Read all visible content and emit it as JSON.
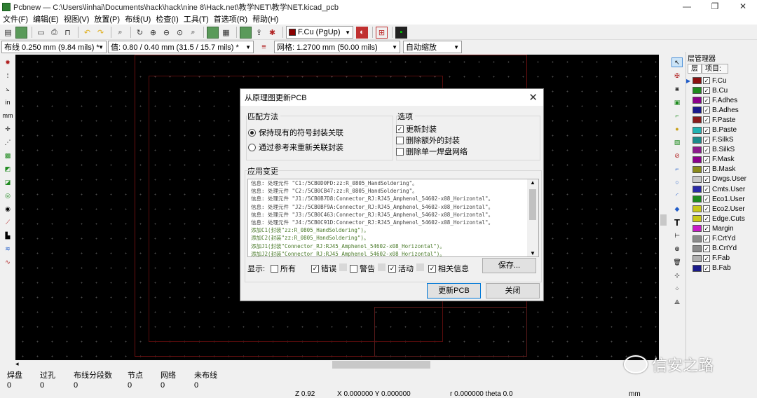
{
  "window": {
    "title": "Pcbnew — C:\\Users\\linhai\\Documents\\hack\\hack\\nine 8\\Hack.net\\教学NET\\教学NET.kicad_pcb",
    "min": "—",
    "restore": "❐",
    "close": "✕"
  },
  "menu": [
    "文件(F)",
    "编辑(E)",
    "视图(V)",
    "放置(P)",
    "布线(U)",
    "检查(I)",
    "工具(T)",
    "首选项(R)",
    "帮助(H)"
  ],
  "toolbar": {
    "layer_combo": "F.Cu (PgUp)",
    "layer_color": "#8b0000"
  },
  "toolbar2": {
    "track": "布线 0.250 mm (9.84 mils) *",
    "via": "值:  0.80 / 0.40 mm (31.5 / 15.7 mils) *",
    "grid": "网格: 1.2700 mm (50.00 mils)",
    "zoom": "自动缩放"
  },
  "layers_panel": {
    "title": "层管理器",
    "tab_layers": "层",
    "tab_items": "项目:",
    "items": [
      {
        "name": "F.Cu",
        "color": "#8b1010"
      },
      {
        "name": "B.Cu",
        "color": "#1e8a1e"
      },
      {
        "name": "F.Adhes",
        "color": "#8b008b"
      },
      {
        "name": "B.Adhes",
        "color": "#1a1a8b"
      },
      {
        "name": "F.Paste",
        "color": "#8b1a1a"
      },
      {
        "name": "B.Paste",
        "color": "#20b2b2"
      },
      {
        "name": "F.SilkS",
        "color": "#1a8a8a"
      },
      {
        "name": "B.SilkS",
        "color": "#8b1a8b"
      },
      {
        "name": "F.Mask",
        "color": "#8b008b"
      },
      {
        "name": "B.Mask",
        "color": "#8b8b1a"
      },
      {
        "name": "Dwgs.User",
        "color": "#c8c8c8"
      },
      {
        "name": "Cmts.User",
        "color": "#2a2aa8"
      },
      {
        "name": "Eco1.User",
        "color": "#1e8a1e"
      },
      {
        "name": "Eco2.User",
        "color": "#c8c81a"
      },
      {
        "name": "Edge.Cuts",
        "color": "#c8c81a"
      },
      {
        "name": "Margin",
        "color": "#c81ac8"
      },
      {
        "name": "F.CrtYd",
        "color": "#8a8a8a"
      },
      {
        "name": "B.CrtYd",
        "color": "#8a8a8a"
      },
      {
        "name": "F.Fab",
        "color": "#b0b0b0"
      },
      {
        "name": "B.Fab",
        "color": "#1a1a8b"
      }
    ]
  },
  "status": {
    "cols": [
      {
        "label": "焊盘",
        "value": "0"
      },
      {
        "label": "过孔",
        "value": "0"
      },
      {
        "label": "布线分段数",
        "value": "0"
      },
      {
        "label": "节点",
        "value": "0"
      },
      {
        "label": "网络",
        "value": "0"
      },
      {
        "label": "未布线",
        "value": "0"
      }
    ],
    "zoom": "Z 0.92",
    "xy": "X 0.000000  Y 0.000000",
    "polar": "r 0.000000  theta 0.0",
    "units": "mm"
  },
  "watermark": "信安之路",
  "dialog": {
    "title": "从原理图更新PCB",
    "match_title": "匹配方法",
    "radio1": "保持现有的符号封装关联",
    "radio2": "通过参考来重新关联封装",
    "options_title": "选项",
    "opt1": "更新封装",
    "opt2": "删除额外的封装",
    "opt3": "删除单一焊盘网络",
    "changes_title": "应用变更",
    "messages": [
      "信息:  处理元件 \"C1:/5CB0D0FD:zz:R_0805_HandSoldering\"。",
      "信息:  处理元件 \"C2:/5CB0CB47:zz:R_0805_HandSoldering\"。",
      "信息:  处理元件 \"J1:/5CB0B7D8:Connector_RJ:RJ45_Amphenol_54602-x08_Horizontal\"。",
      "信息:  处理元件 \"J2:/5CB0BF9A:Connector_RJ:RJ45_Amphenol_54602-x08_Horizontal\"。",
      "信息:  处理元件 \"J3:/5CB0C463:Connector_RJ:RJ45_Amphenol_54602-x08_Horizontal\"。",
      "信息:  处理元件 \"J4:/5CB0C91D:Connector_RJ:RJ45_Amphenol_54602-x08_Horizontal\"。",
      "添加C1(封装\"zz:R_0805_HandSoldering\")。",
      "添加C2(封装\"zz:R_0805_HandSoldering\")。",
      "添加J1(封装\"Connector_RJ:RJ45_Amphenol_54602-x08_Horizontal\")。",
      "添加J2(封装\"Connector_RJ:RJ45_Amphenol_54602-x08_Horizontal\")。"
    ],
    "show_label": "显示:",
    "f_all": "所有",
    "f_error": "错误",
    "f_warn": "警告",
    "f_action": "活动",
    "f_info": "相关信息",
    "save": "保存...",
    "update": "更新PCB",
    "close": "关闭"
  }
}
